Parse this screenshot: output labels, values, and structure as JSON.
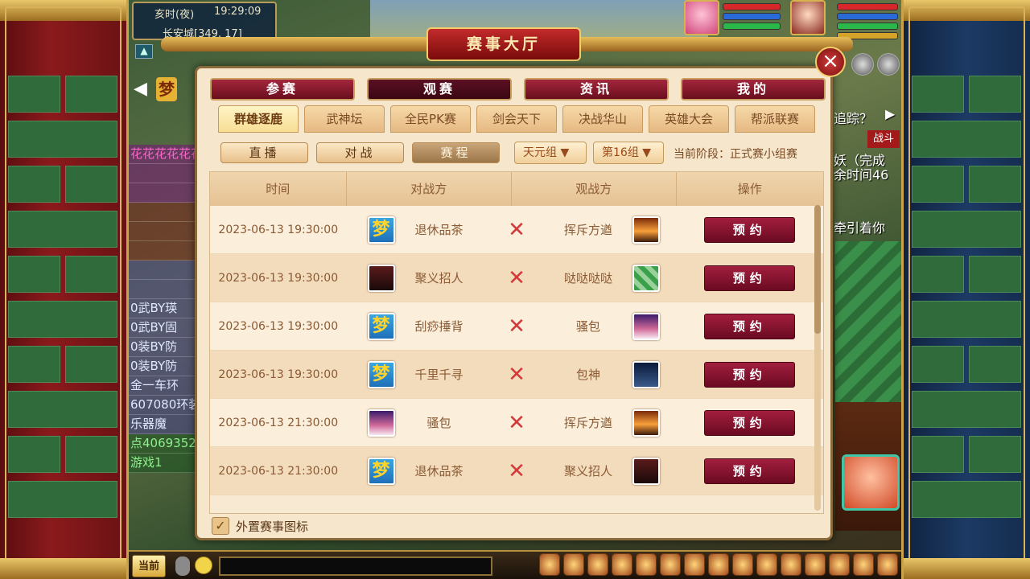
{
  "top_left": {
    "period": "亥时(夜)",
    "clock": "19:29:09",
    "location": "长安城[349, 17]"
  },
  "left_arrow_icon": "chevron-left-icon",
  "chat_lines": [
    "花花花花花花",
    "0武BY瑛",
    "0武BY固",
    "0装BY防",
    "0装BY防",
    "金一车环",
    "607080环装",
    "乐器魔",
    "点4069352",
    "游戏1"
  ],
  "right_side": {
    "track": "追踪？",
    "battle": "战斗",
    "quest1": "妖（完成",
    "quest2": "余时间46",
    "attract": "牵引着你"
  },
  "dialog": {
    "title": "赛事大厅",
    "close_label": "×",
    "main_tabs": [
      "参赛",
      "观赛",
      "资讯",
      "我的"
    ],
    "active_main_tab": "观赛",
    "sub_tabs": [
      "群雄逐鹿",
      "武神坛",
      "全民PK赛",
      "剑会天下",
      "决战华山",
      "英雄大会",
      "帮派联赛"
    ],
    "active_sub_tab": "群雄逐鹿",
    "view_buttons": [
      "直播",
      "对战",
      "赛程"
    ],
    "active_view_button": "赛程",
    "group_dropdown": "天元组",
    "subgroup_dropdown": "第16组",
    "stage_label": "当前阶段：",
    "stage_value": "正式赛小组赛",
    "columns": [
      "时间",
      "对战方",
      "观战方",
      "操作"
    ],
    "rows": [
      {
        "time": "2023-06-13 19:30:00",
        "team_a": "退休品茶",
        "team_a_icon": "dream",
        "team_b": "挥斥方遒",
        "team_b_icon": "sunset",
        "action": "预约"
      },
      {
        "time": "2023-06-13 19:30:00",
        "team_a": "聚义招人",
        "team_a_icon": "war",
        "team_b": "哒哒哒哒",
        "team_b_icon": "tiles",
        "action": "预约"
      },
      {
        "time": "2023-06-13 19:30:00",
        "team_a": "刮痧捶背",
        "team_a_icon": "dream",
        "team_b": "骚包",
        "team_b_icon": "mount",
        "action": "预约"
      },
      {
        "time": "2023-06-13 19:30:00",
        "team_a": "千里千寻",
        "team_a_icon": "dream",
        "team_b": "包神",
        "team_b_icon": "moon",
        "action": "预约"
      },
      {
        "time": "2023-06-13 21:30:00",
        "team_a": "骚包",
        "team_a_icon": "mount",
        "team_b": "挥斥方遒",
        "team_b_icon": "sunset",
        "action": "预约"
      },
      {
        "time": "2023-06-13 21:30:00",
        "team_a": "退休品茶",
        "team_a_icon": "dream",
        "team_b": "聚义招人",
        "team_b_icon": "war",
        "action": "预约"
      }
    ],
    "external_icon_label": "外置赛事图标",
    "external_icon_checked": true
  },
  "bottom": {
    "current_channel": "当前"
  },
  "colors": {
    "accent_red": "#8a1230",
    "panel_bg": "#f5e6cc",
    "gold": "#d9b25a"
  }
}
